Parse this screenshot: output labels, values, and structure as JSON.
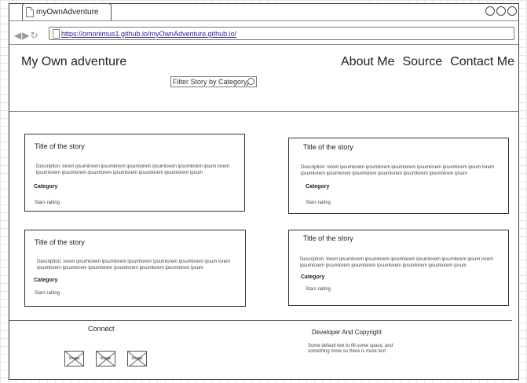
{
  "browser": {
    "tab_title": "myOwnAdventure",
    "url": "https://omonimus1.github.io/myOwnAdventure.github.io/"
  },
  "header": {
    "brand": "My Own adventure",
    "nav": {
      "about": "About Me",
      "source": "Source",
      "contact": "Contact Me"
    },
    "filter_placeholder": "Filter Story by Category"
  },
  "stories": [
    {
      "title": "Title of the story",
      "description": "Description: lorem ipsumlorem ipsumlorem ipsumlorem ipsumlorem ipsumlorem ipsum lorem ipsumlorem ipsumlorem ipsumlorem ipsumlorem ipsumlorem ipsumlorem ipsum",
      "category": "Category",
      "rating": "Stars raiting"
    },
    {
      "title": "Title of the story",
      "description": "Description: lorem ipsumlorem ipsumlorem ipsumlorem ipsumlorem ipsumlorem ipsum lorem ipsumlorem ipsumlorem ipsumlorem ipsumlorem ipsumlorem ipsumlorem ipsum",
      "category": "Category",
      "rating": "Stars raiting"
    },
    {
      "title": "Title of the story",
      "description": "Description: lorem ipsumlorem ipsumlorem ipsumlorem ipsumlorem ipsumlorem ipsum lorem ipsumlorem ipsumlorem ipsumlorem ipsumlorem ipsumlorem ipsumlorem ipsum",
      "category": "Category",
      "rating": "Stars raiting"
    },
    {
      "title": "Title of the story",
      "description": "Description: lorem ipsumlorem ipsumlorem ipsumlorem ipsumlorem ipsumlorem ipsum lorem ipsumlorem ipsumlorem ipsumlorem ipsumlorem ipsumlorem ipsumlorem ipsum",
      "category": "Category",
      "rating": "Stars raiting"
    }
  ],
  "footer": {
    "connect": "Connect",
    "social_placeholder": "Image",
    "developer_title": "Developer And Copyright",
    "developer_text": "Some default text to fill some space, and something more so there is more text"
  },
  "icons": {
    "page": "page-icon",
    "back": "back-arrow-icon",
    "forward": "forward-arrow-icon",
    "refresh": "refresh-icon",
    "search": "search-icon",
    "window_controls": "circle-icon"
  }
}
